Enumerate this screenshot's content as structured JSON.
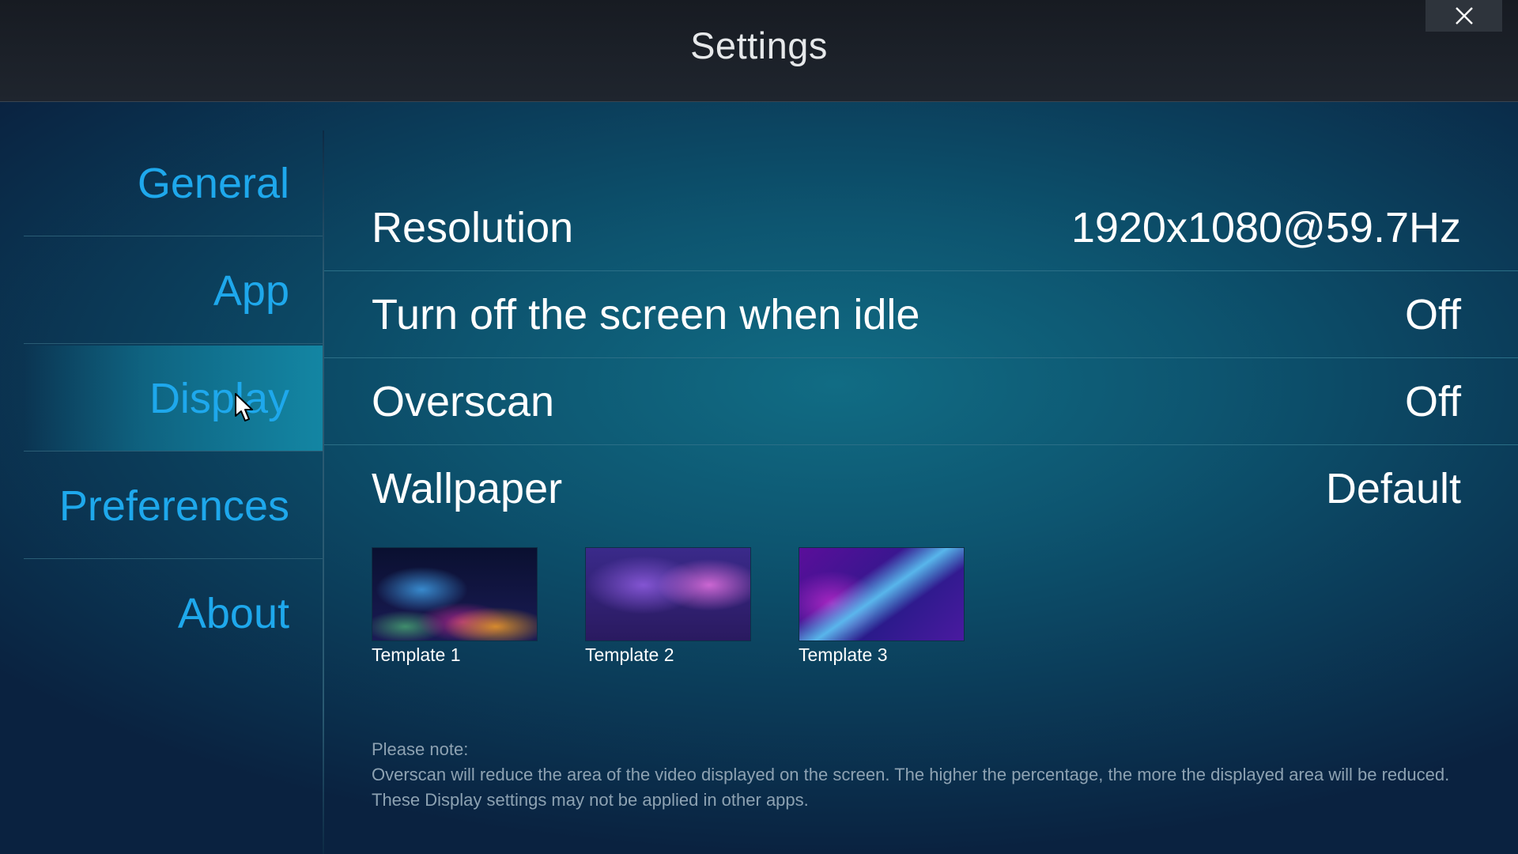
{
  "header": {
    "title": "Settings",
    "close_icon": "close-icon"
  },
  "sidebar": {
    "items": [
      {
        "label": "General"
      },
      {
        "label": "App"
      },
      {
        "label": "Display",
        "active": true
      },
      {
        "label": "Preferences"
      },
      {
        "label": "About"
      }
    ]
  },
  "display": {
    "rows": [
      {
        "label": "Resolution",
        "value": "1920x1080@59.7Hz"
      },
      {
        "label": "Turn off the screen when idle",
        "value": "Off"
      },
      {
        "label": "Overscan",
        "value": "Off"
      },
      {
        "label": "Wallpaper",
        "value": "Default"
      }
    ],
    "wallpapers": [
      {
        "label": "Template 1"
      },
      {
        "label": "Template 2"
      },
      {
        "label": "Template 3"
      }
    ],
    "note": {
      "heading": "Please note:",
      "line1": "Overscan will reduce the area of the video displayed on the screen. The higher the percentage, the more the displayed area will be reduced.",
      "line2": "These Display settings may not be applied in other apps."
    }
  },
  "colors": {
    "accent": "#1ea8ec",
    "text": "#ffffff",
    "note_text": "#8da2b2"
  }
}
